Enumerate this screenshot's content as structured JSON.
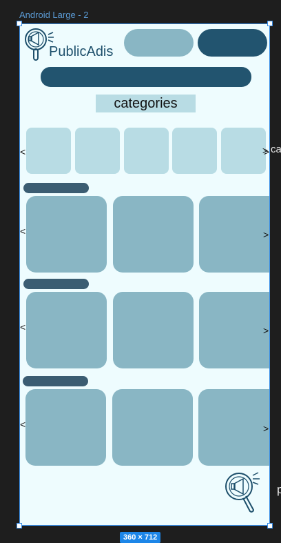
{
  "canvas": {
    "frame_label": "Android Large - 2",
    "size_badge": "360 × 712",
    "selection_color": "#3a8ee6"
  },
  "header": {
    "brand_name": "PublicAdis",
    "logo_icon": "magnifier-megaphone-icon",
    "button_1_color": "#89b6c4",
    "button_2_color": "#22546f"
  },
  "search": {
    "bar_color": "#22546f"
  },
  "categories": {
    "label": "categories",
    "tile_count_visible": 5,
    "prev_arrow": "<",
    "next_arrow": ">",
    "overflow_text": "ca"
  },
  "sections": [
    {
      "prev_arrow": "<",
      "next_arrow": ">"
    },
    {
      "prev_arrow": "<",
      "next_arrow": ">"
    },
    {
      "prev_arrow": "<",
      "next_arrow": ">"
    }
  ],
  "footer": {
    "logo_icon": "magnifier-megaphone-icon",
    "overflow_text": "p"
  },
  "colors": {
    "background": "#eefcfe",
    "tile_light": "#b8dce4",
    "card": "#89b6c4",
    "section_title": "#3b5d72",
    "dark_accent": "#22546f"
  }
}
